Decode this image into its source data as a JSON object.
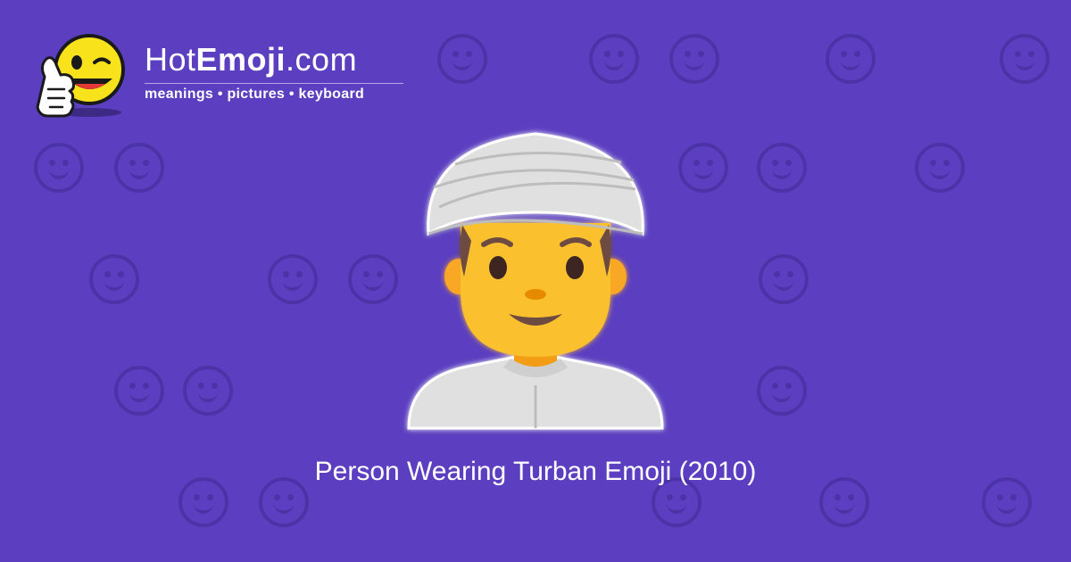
{
  "logo": {
    "name_regular": "Hot",
    "name_bold": "Emoji",
    "name_suffix": ".com",
    "tagline": "meanings • pictures • keyboard",
    "icon": "thumbs-up-wink-smiley-icon"
  },
  "hero": {
    "icon": "person-wearing-turban-icon"
  },
  "caption": "Person Wearing Turban Emoji (2010)",
  "colors": {
    "background": "#5b3fc0",
    "pattern": "#4a32a5",
    "face": "#fbc02d",
    "turban": "#e0e0e0"
  }
}
